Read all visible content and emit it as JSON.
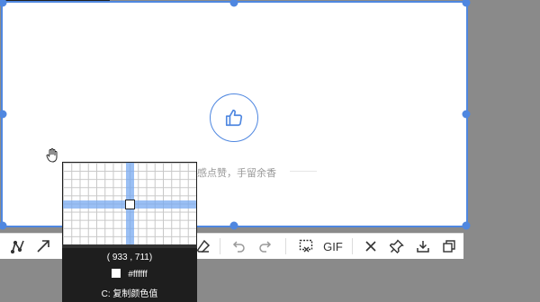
{
  "capture": {
    "like_caption": "感点赞，手留余香"
  },
  "toolbar": {
    "tools": [
      {
        "name": "polyline-tool",
        "icon": "polyline-icon"
      },
      {
        "name": "arrow-tool",
        "icon": "arrow-icon"
      },
      {
        "name": "eraser-tool",
        "icon": "eraser-icon"
      },
      {
        "name": "undo",
        "icon": "undo-icon"
      },
      {
        "name": "redo",
        "icon": "redo-icon"
      },
      {
        "name": "scroll-capture",
        "icon": "scroll-capture-icon"
      },
      {
        "name": "gif",
        "icon": "gif-label"
      },
      {
        "name": "close",
        "icon": "close-icon"
      },
      {
        "name": "pin",
        "icon": "pin-icon"
      },
      {
        "name": "download",
        "icon": "download-icon"
      },
      {
        "name": "copy",
        "icon": "copy-icon"
      }
    ],
    "gif_label": "GIF"
  },
  "magnifier": {
    "coords": "( 933 ,  711)",
    "hex": "#ffffff",
    "copy_hint": "C: 复制颜色值"
  },
  "colors": {
    "accent": "#4f87e0",
    "background": "#8a8a8a",
    "magnifier_bg": "#1e1e1e"
  }
}
